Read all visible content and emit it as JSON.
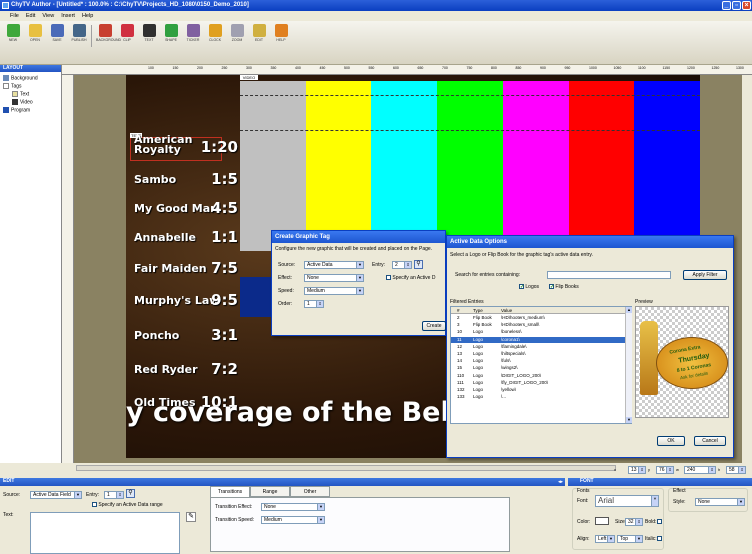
{
  "window": {
    "title": "ChyTV Author - [Untitled* : 100.0% : C:\\ChyTV\\Projects_HD_1080\\0150_Demo_2010]",
    "min": "_",
    "max": "▫",
    "close": "×"
  },
  "menu": [
    "File",
    "Edit",
    "View",
    "Insert",
    "Help"
  ],
  "toolbar": [
    {
      "label": "NEW",
      "icon": "new-icon",
      "color": "#3fa83c"
    },
    {
      "label": "OPEN",
      "icon": "folder-icon",
      "color": "#e8c040"
    },
    {
      "label": "SAVE",
      "icon": "save-icon",
      "color": "#4a6ab8"
    },
    {
      "label": "PUBLISH",
      "icon": "publish-icon",
      "color": "#446688"
    },
    {
      "label": "BACKGROUND",
      "icon": "background-icon",
      "color": "#c84030"
    },
    {
      "label": "CLIP",
      "icon": "clip-icon",
      "color": "#d03040"
    },
    {
      "label": "TEXT",
      "icon": "text-icon",
      "color": "#303030"
    },
    {
      "label": "SHAPE",
      "icon": "shape-icon",
      "color": "#30a040"
    },
    {
      "label": "TICKER",
      "icon": "ticker-icon",
      "color": "#8060a0"
    },
    {
      "label": "CLOCK",
      "icon": "clock-icon",
      "color": "#e0a020"
    },
    {
      "label": "ZOOM",
      "icon": "zoom-icon",
      "color": "#a0a0b0"
    },
    {
      "label": "EDIT",
      "icon": "edit-icon",
      "color": "#d0b040"
    },
    {
      "label": "HELP",
      "icon": "help-icon",
      "color": "#e08020"
    }
  ],
  "tree": {
    "header": "LAYOUT",
    "items": [
      "Background",
      "Tags",
      "Text",
      "Video",
      "Program"
    ]
  },
  "ruler_ticks": [
    "100",
    "150",
    "200",
    "250",
    "300",
    "350",
    "400",
    "450",
    "500",
    "550",
    "600",
    "650",
    "700",
    "750",
    "800",
    "850",
    "900",
    "950",
    "1000",
    "1050",
    "1100",
    "1150",
    "1200",
    "1250",
    "1300"
  ],
  "stage": {
    "tag_label": "TEXT",
    "corner_label": "VIDEO",
    "bars": [
      "#c0c0c0",
      "#ffff00",
      "#00ffff",
      "#00ff00",
      "#ff00ff",
      "#ff0000",
      "#0000ff"
    ],
    "entries": [
      {
        "name": "American Royalty",
        "score": "1:20"
      },
      {
        "name": "Sambo",
        "score": "1:5"
      },
      {
        "name": "My Good Man",
        "score": "4:5"
      },
      {
        "name": "Annabelle",
        "score": "1:1"
      },
      {
        "name": "Fair Maiden",
        "score": "7:5"
      },
      {
        "name": "Murphy's Law",
        "score": "9:5"
      },
      {
        "name": "Poncho",
        "score": "3:1"
      },
      {
        "name": "Red Ryder",
        "score": "7:2"
      },
      {
        "name": "Old Times",
        "score": "10:1"
      }
    ],
    "ticker": "y coverage of the Belmont Stakes"
  },
  "create_tag": {
    "title": "Create Graphic Tag",
    "desc": "Configure the new graphic that will be created and placed on the Page.",
    "source_label": "Source:",
    "source": "Active Data",
    "entry_label": "Entry:",
    "entry": "2",
    "effect_label": "Effect:",
    "effect": "None",
    "speed_label": "Speed:",
    "speed": "Medium",
    "order_label": "Order:",
    "order": "1",
    "specify_label": "Specify an Active D",
    "create_btn": "Create"
  },
  "active_data": {
    "title": "Active Data Options",
    "desc": "Select a Logo or Flip Book for the graphic tag's active data entry.",
    "search_label": "Search for entries containing:",
    "apply_btn": "Apply Filter",
    "logos_label": "Logos",
    "flipbooks_label": "Flip Books",
    "filtered_label": "Filtered Entries",
    "preview_label": "Preview",
    "columns": [
      "#",
      "Type",
      "Value"
    ],
    "rows": [
      [
        "2",
        "Flip Book",
        "\\HD\\hooters_medium\\"
      ],
      [
        "3",
        "Flip Book",
        "\\HD\\hooters_small\\"
      ],
      [
        "10",
        "Logo",
        "\\boneless\\"
      ],
      [
        "11",
        "Logo",
        "\\corona1\\"
      ],
      [
        "12",
        "Logo",
        "\\flamingdale\\"
      ],
      [
        "13",
        "Logo",
        "\\hiltspecials\\"
      ],
      [
        "14",
        "Logo",
        "\\fuls\\"
      ],
      [
        "15",
        "Logo",
        "\\wings2\\"
      ],
      [
        "110",
        "Logo",
        "\\DIGIT_LOGO_200\\"
      ],
      [
        "111",
        "Logo",
        "\\fly_DIGIT_LOGO_200\\"
      ],
      [
        "132",
        "Logo",
        "\\yellow\\"
      ],
      [
        "133",
        "Logo",
        "\\..."
      ]
    ],
    "selected_index": 3,
    "preview_text": [
      "Corona Extra",
      "Thursday",
      "8 to 1 Coronas",
      "Ask for details"
    ],
    "ok_btn": "OK",
    "cancel_btn": "Cancel"
  },
  "zoom": {
    "x": "13",
    "y": "76",
    "w": "240",
    "h": "58"
  },
  "lower_left": {
    "header": "EDIT",
    "source_label": "Source:",
    "source": "Active Data Field",
    "entry_label": "Entry:",
    "entry": "1",
    "specify_label": "Specify an Active Data range",
    "text_label": "Text:"
  },
  "lower_tabs": [
    "Transitions",
    "Range",
    "Other"
  ],
  "transitions": {
    "effect_label": "Transition Effect:",
    "effect": "None",
    "speed_label": "Transition Speed:",
    "speed": "Medium"
  },
  "font_panel": {
    "header": "FONT",
    "group_label": "Fonts",
    "font_label": "Font:",
    "font": "Arial",
    "color_label": "Color:",
    "size_label": "Size:",
    "size": "32",
    "bold_label": "Bold:",
    "align_label": "Align:",
    "align": "Left",
    "valign": "Top",
    "italic_label": "Italic:",
    "effect_group": "Effect",
    "style_label": "Style:",
    "style": "None"
  }
}
